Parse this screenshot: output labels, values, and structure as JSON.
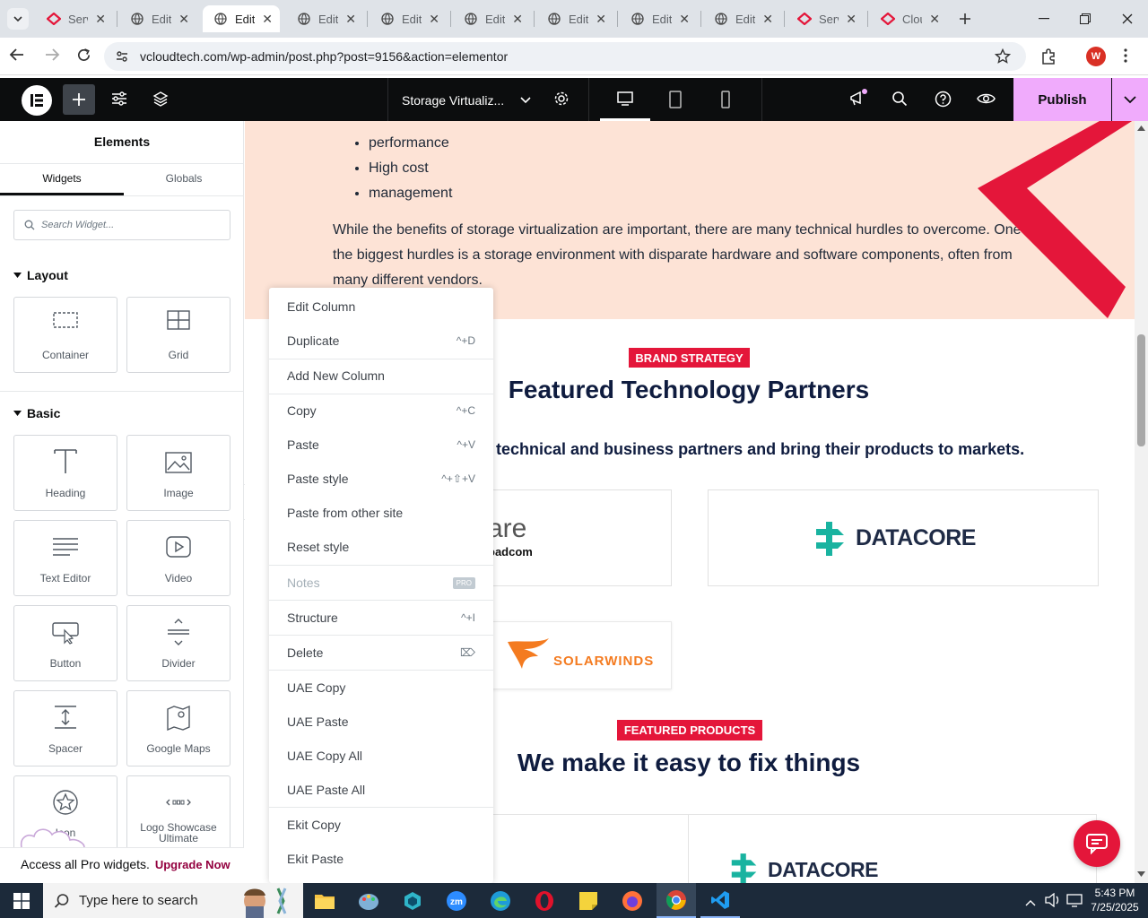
{
  "browser": {
    "tabs": [
      {
        "label": "Serv",
        "icon": "red-diamond"
      },
      {
        "label": "Edit",
        "icon": "wordpress"
      },
      {
        "label": "Edit",
        "icon": "wordpress",
        "active": true
      },
      {
        "label": "Edit",
        "icon": "wordpress"
      },
      {
        "label": "Edit",
        "icon": "wordpress"
      },
      {
        "label": "Edit",
        "icon": "wordpress"
      },
      {
        "label": "Edit",
        "icon": "wordpress"
      },
      {
        "label": "Edit",
        "icon": "wordpress"
      },
      {
        "label": "Edit",
        "icon": "wordpress"
      },
      {
        "label": "Serv",
        "icon": "red-diamond"
      },
      {
        "label": "Clou",
        "icon": "red-diamond"
      }
    ],
    "url": "vcloudtech.com/wp-admin/post.php?post=9156&action=elementor",
    "profile_initial": "W"
  },
  "topbar": {
    "page_title": "Storage Virtualiz...",
    "publish_label": "Publish"
  },
  "sidebar": {
    "title": "Elements",
    "tabs": [
      "Widgets",
      "Globals"
    ],
    "search_placeholder": "Search Widget...",
    "section_layout": "Layout",
    "section_basic": "Basic",
    "layout_widgets": [
      "Container",
      "Grid"
    ],
    "basic_widgets": [
      "Heading",
      "Image",
      "Text Editor",
      "Video",
      "Button",
      "Divider",
      "Spacer",
      "Google Maps",
      "Icon",
      "Logo Showcase Ultimate"
    ],
    "promo_text": "Access all Pro widgets.",
    "promo_link": "Upgrade Now"
  },
  "canvas": {
    "bullets": [
      "performance",
      "High cost",
      "management"
    ],
    "paragraph": "While the benefits of storage virtualization are important, there are many technical hurdles to overcome. One of the biggest hurdles is a storage environment with disparate hardware and software components, often from many different vendors.",
    "badge1": "BRAND STRATEGY",
    "heading1": "Featured Technology Partners",
    "subheading1": "technical and business partners and bring their products to markets.",
    "logo_vmware_partial": "are",
    "logo_broadcom_partial": "oadcom",
    "logo_datacore": "DATACORE",
    "logo_solarwinds": "SOLARWINDS",
    "badge2": "FEATURED PRODUCTS",
    "heading2": "We make it easy to fix things",
    "logo_datacore2": "DATACORE"
  },
  "context_menu": {
    "items": [
      {
        "label": "Edit Column",
        "shortcut": ""
      },
      {
        "label": "Duplicate",
        "shortcut": "^+D"
      },
      {
        "label": "Add New Column",
        "shortcut": ""
      },
      {
        "label": "Copy",
        "shortcut": "^+C"
      },
      {
        "label": "Paste",
        "shortcut": "^+V"
      },
      {
        "label": "Paste style",
        "shortcut": "^+⇧+V"
      },
      {
        "label": "Paste from other site",
        "shortcut": ""
      },
      {
        "label": "Reset style",
        "shortcut": ""
      },
      {
        "label": "Notes",
        "shortcut": "PRO"
      },
      {
        "label": "Structure",
        "shortcut": "^+I"
      },
      {
        "label": "Delete",
        "shortcut": "⌦"
      },
      {
        "label": "UAE Copy",
        "shortcut": ""
      },
      {
        "label": "UAE Paste",
        "shortcut": ""
      },
      {
        "label": "UAE Copy All",
        "shortcut": ""
      },
      {
        "label": "UAE Paste All",
        "shortcut": ""
      },
      {
        "label": "Ekit Copy",
        "shortcut": ""
      },
      {
        "label": "Ekit Paste",
        "shortcut": ""
      }
    ]
  },
  "taskbar": {
    "search_placeholder": "Type here to search",
    "time": "5:43 PM",
    "date": "7/25/2025"
  },
  "colors": {
    "elementor_black": "#0c0d0e",
    "publish_bg": "#f0abfc",
    "accent_red": "#e4163a",
    "heading_navy": "#0f1c3f",
    "canvas_peach": "#fde3d6"
  }
}
